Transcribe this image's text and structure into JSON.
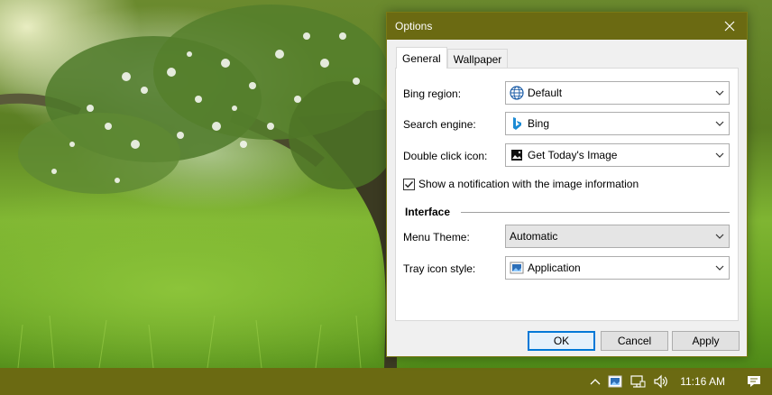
{
  "window": {
    "title": "Options"
  },
  "tabs": [
    {
      "label": "General",
      "active": true
    },
    {
      "label": "Wallpaper",
      "active": false
    }
  ],
  "general": {
    "bing_region": {
      "label": "Bing region:",
      "value": "Default",
      "icon": "globe-icon"
    },
    "search_engine": {
      "label": "Search engine:",
      "value": "Bing",
      "icon": "bing-logo-icon"
    },
    "double_click_icon": {
      "label": "Double click icon:",
      "value": "Get Today's Image",
      "icon": "image-icon"
    },
    "show_notification": {
      "label": "Show a notification with the image information",
      "checked": true
    }
  },
  "interface": {
    "section_title": "Interface",
    "menu_theme": {
      "label": "Menu Theme:",
      "value": "Automatic"
    },
    "tray_icon_style": {
      "label": "Tray icon style:",
      "value": "Application",
      "icon": "application-icon"
    }
  },
  "buttons": {
    "ok": "OK",
    "cancel": "Cancel",
    "apply": "Apply"
  },
  "taskbar": {
    "time": "11:16 AM"
  },
  "colors": {
    "accent": "#6b6a12",
    "focus": "#0078d7"
  }
}
